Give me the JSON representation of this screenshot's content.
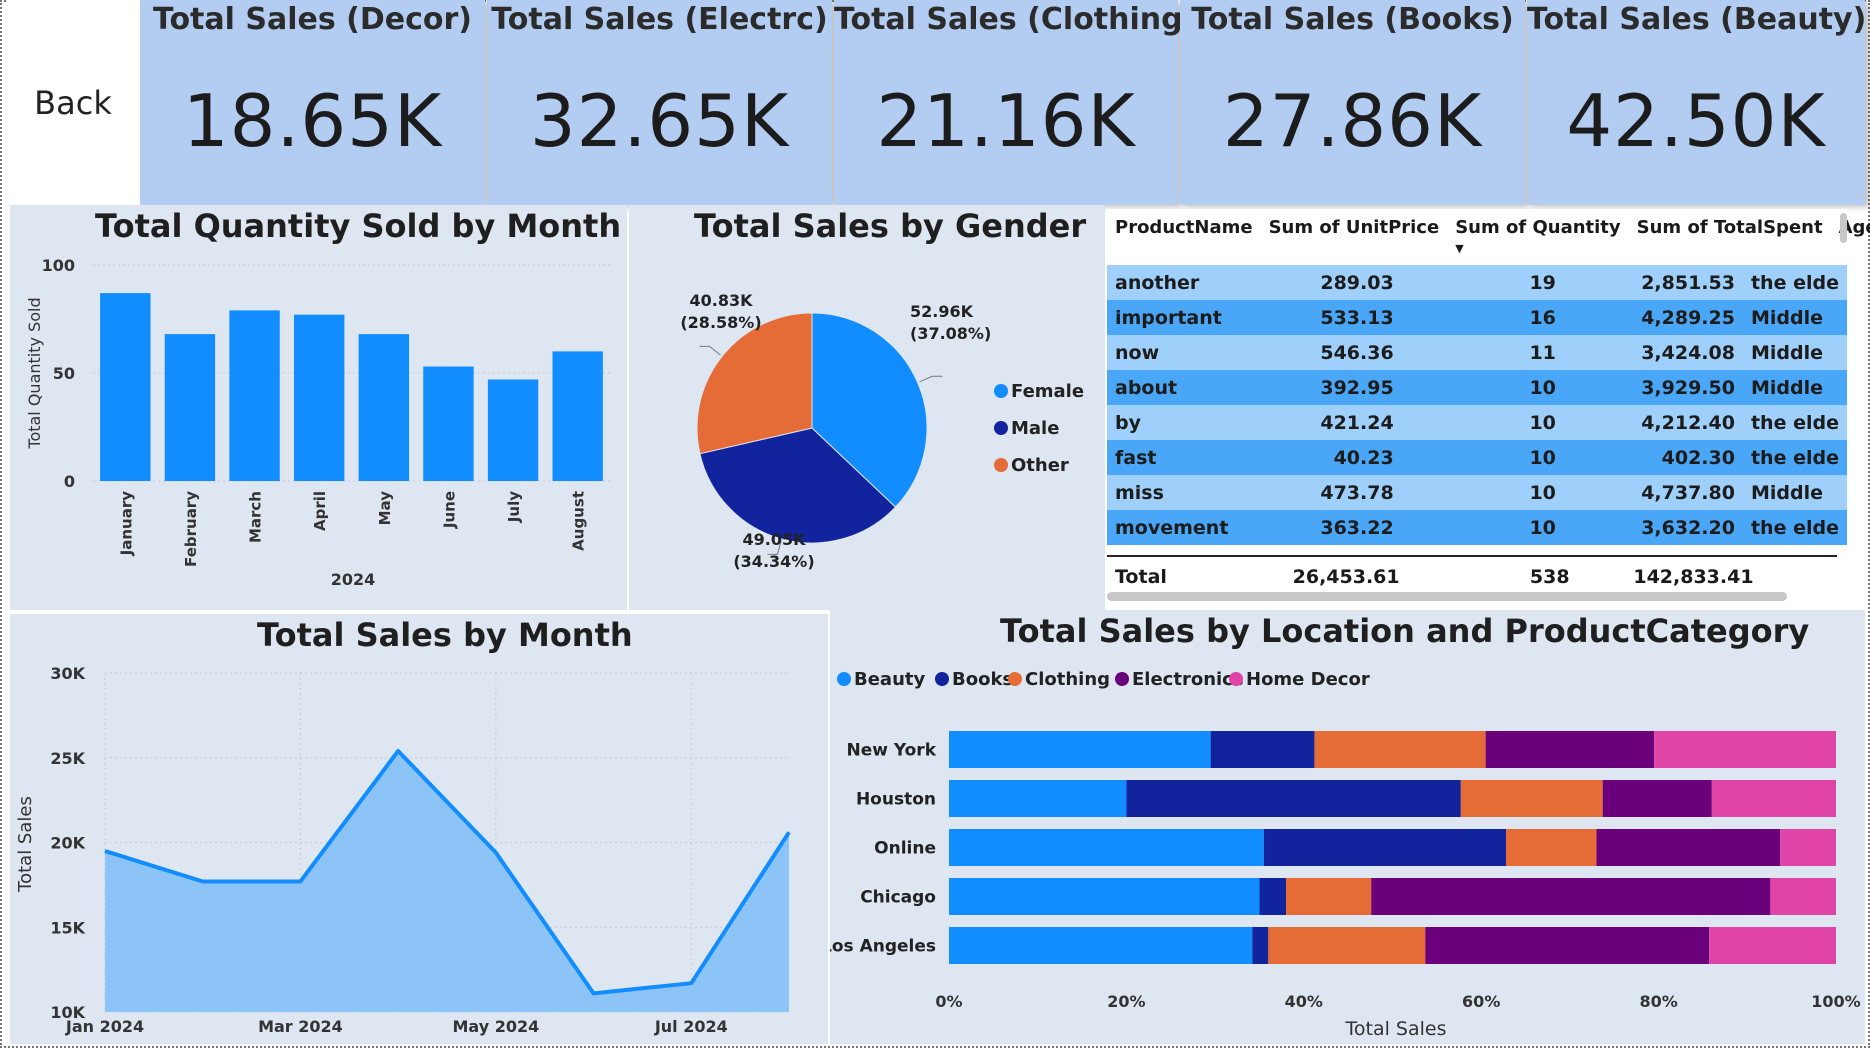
{
  "back_label": "Back",
  "kpis": [
    {
      "title": "Total Sales (Decor)",
      "value": "18.65K"
    },
    {
      "title": "Total Sales (Electrc)",
      "value": "32.65K"
    },
    {
      "title": "Total Sales (Clothing)",
      "value": "21.16K"
    },
    {
      "title": "Total Sales (Books)",
      "value": "27.86K"
    },
    {
      "title": "Total Sales (Beauty)",
      "value": "42.50K"
    }
  ],
  "colors": {
    "kpi_bg": "#b3cdf2",
    "panel_bg": "#dde6f1",
    "bar_blue": "#118dff",
    "navy": "#12239e",
    "orange": "#e66c37",
    "purple": "#6b007b",
    "pink": "#e044a7",
    "row_light": "#9fd0fb",
    "row_dark": "#4aa6f6"
  },
  "table": {
    "columns": [
      "ProductName",
      "Sum of UnitPrice",
      "Sum of Quantity",
      "Sum of TotalSpent",
      "Age Seg"
    ],
    "sort_indicator": "▼",
    "rows": [
      [
        "another",
        "289.03",
        "19",
        "2,851.53",
        "the elde"
      ],
      [
        "important",
        "533.13",
        "16",
        "4,289.25",
        "Middle"
      ],
      [
        "now",
        "546.36",
        "11",
        "3,424.08",
        "Middle"
      ],
      [
        "about",
        "392.95",
        "10",
        "3,929.50",
        "Middle"
      ],
      [
        "by",
        "421.24",
        "10",
        "4,212.40",
        "the elde"
      ],
      [
        "fast",
        "40.23",
        "10",
        "402.30",
        "the elde"
      ],
      [
        "miss",
        "473.78",
        "10",
        "4,737.80",
        "Middle"
      ],
      [
        "movement",
        "363.22",
        "10",
        "3,632.20",
        "the elde"
      ]
    ],
    "total": [
      "Total",
      "26,453.61",
      "538",
      "142,833.41",
      ""
    ]
  },
  "chart_data": [
    {
      "type": "bar",
      "title": "Total Quantity Sold by Month",
      "categories": [
        "January",
        "February",
        "March",
        "April",
        "May",
        "June",
        "July",
        "August"
      ],
      "values": [
        87,
        68,
        79,
        77,
        68,
        53,
        47,
        60
      ],
      "ylabel": "Total Quantity Sold",
      "xlabel": "2024",
      "ylim": [
        0,
        100
      ],
      "yticks": [
        0,
        50,
        100
      ],
      "grid": true
    },
    {
      "type": "pie",
      "title": "Total Sales by Gender",
      "categories": [
        "Female",
        "Male",
        "Other"
      ],
      "values": [
        52.96,
        49.05,
        40.83
      ],
      "data_labels": [
        "52.96K",
        "49.05K",
        "40.83K"
      ],
      "percent_labels": [
        "(37.08%)",
        "(34.34%)",
        "(28.58%)"
      ],
      "legend_position": "right"
    },
    {
      "type": "area",
      "title": "Total Sales by Month",
      "x": [
        "Jan 2024",
        "Feb 2024",
        "Mar 2024",
        "Apr 2024",
        "May 2024",
        "Jun 2024",
        "Jul 2024",
        "Aug 2024"
      ],
      "values": [
        19500,
        17700,
        17700,
        25400,
        19400,
        11100,
        11700,
        20600
      ],
      "xticks": [
        "Jan 2024",
        "Mar 2024",
        "May 2024",
        "Jul 2024"
      ],
      "yticks": [
        "10K",
        "15K",
        "20K",
        "25K",
        "30K"
      ],
      "ylabel": "Total Sales",
      "ylim": [
        10000,
        30000
      ],
      "grid": true
    },
    {
      "type": "bar",
      "orientation": "horizontal",
      "stacked": "100%",
      "title": "Total Sales by Location and ProductCategory",
      "categories": [
        "New York",
        "Houston",
        "Online",
        "Chicago",
        "Los Angeles"
      ],
      "series": [
        {
          "name": "Beauty",
          "values": [
            29.5,
            20,
            35.5,
            35,
            34.2
          ]
        },
        {
          "name": "Books",
          "values": [
            11.7,
            37.7,
            27.3,
            3,
            1.8
          ]
        },
        {
          "name": "Clothing",
          "values": [
            19.3,
            16,
            10.2,
            9.6,
            17.7
          ]
        },
        {
          "name": "Electronics",
          "values": [
            19,
            12.3,
            20.7,
            45,
            32
          ]
        },
        {
          "name": "Home Decor",
          "values": [
            20.5,
            14,
            6.3,
            7.4,
            14.3
          ]
        }
      ],
      "xticks": [
        "0%",
        "20%",
        "40%",
        "60%",
        "80%",
        "100%"
      ],
      "xlabel": "Total Sales",
      "legend_position": "top-left"
    }
  ]
}
